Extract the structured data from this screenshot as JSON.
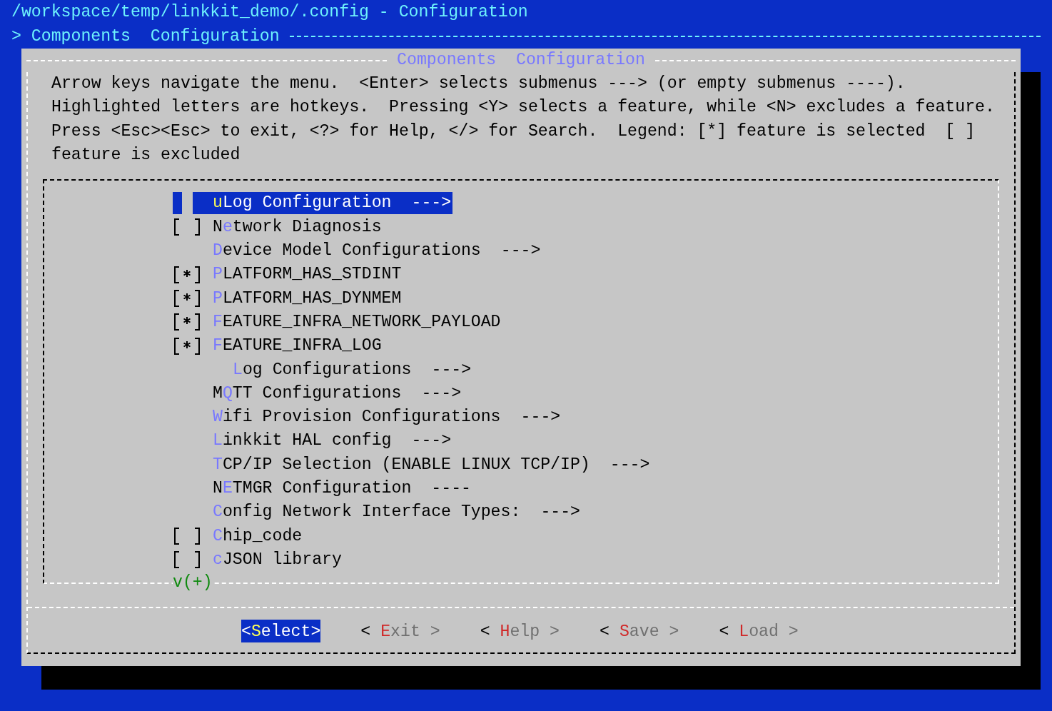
{
  "window": {
    "title": "/workspace/temp/linkkit_demo/.config - Configuration"
  },
  "breadcrumb": "> Components  Configuration",
  "dialog": {
    "title": "Components  Configuration",
    "help_lines": [
      "Arrow keys navigate the menu.  <Enter> selects submenus ---> (or empty submenus ----).",
      "Highlighted letters are hotkeys.  Pressing <Y> selects a feature, while <N> excludes a feature.",
      "Press <Esc><Esc> to exit, <?> for Help, </> for Search.  Legend: [*] feature is selected  [ ]",
      "feature is excluded"
    ]
  },
  "menu": {
    "items": [
      {
        "kind": "submenu",
        "selected": true,
        "hotkey": "u",
        "label_after": "Log Configuration",
        "suffix": "--->"
      },
      {
        "kind": "bool",
        "selected": false,
        "checked": false,
        "label_before": "N",
        "hotkey": "e",
        "label_after": "twork Diagnosis"
      },
      {
        "kind": "submenu",
        "selected": false,
        "hotkey": "D",
        "label_after": "evice Model Configurations",
        "suffix": "--->"
      },
      {
        "kind": "bool",
        "selected": false,
        "checked": true,
        "hotkey": "P",
        "label_after": "LATFORM_HAS_STDINT"
      },
      {
        "kind": "bool",
        "selected": false,
        "checked": true,
        "hotkey": "P",
        "label_after": "LATFORM_HAS_DYNMEM"
      },
      {
        "kind": "bool",
        "selected": false,
        "checked": true,
        "hotkey": "F",
        "label_after": "EATURE_INFRA_NETWORK_PAYLOAD"
      },
      {
        "kind": "bool",
        "selected": false,
        "checked": true,
        "hotkey": "F",
        "label_after": "EATURE_INFRA_LOG",
        "children": [
          {
            "kind": "submenu",
            "selected": false,
            "hotkey": "L",
            "label_after": "og Configurations",
            "suffix": "--->"
          }
        ]
      },
      {
        "kind": "submenu",
        "selected": false,
        "label_before": "M",
        "hotkey": "Q",
        "label_after": "TT Configurations",
        "suffix": "--->"
      },
      {
        "kind": "submenu",
        "selected": false,
        "hotkey": "W",
        "label_after": "ifi Provision Configurations",
        "suffix": "--->"
      },
      {
        "kind": "submenu",
        "selected": false,
        "hotkey": "L",
        "label_after": "inkkit HAL config",
        "suffix": "--->"
      },
      {
        "kind": "submenu",
        "selected": false,
        "hotkey": "T",
        "label_after": "CP/IP Selection (ENABLE LINUX TCP/IP)",
        "suffix": "--->"
      },
      {
        "kind": "submenu",
        "selected": false,
        "label_before": "N",
        "hotkey": "E",
        "label_after": "TMGR Configuration",
        "suffix": "----"
      },
      {
        "kind": "submenu",
        "selected": false,
        "hotkey": "C",
        "label_after": "onfig Network Interface Types:",
        "suffix": "--->"
      },
      {
        "kind": "bool",
        "selected": false,
        "checked": false,
        "hotkey": "C",
        "label_after": "hip_code"
      },
      {
        "kind": "bool",
        "selected": false,
        "checked": false,
        "hotkey": "c",
        "label_after": "JSON library"
      }
    ],
    "more_indicator": "v(+)"
  },
  "buttons": [
    {
      "label_before": "<",
      "hotkey": "S",
      "label_after": "elect>",
      "selected": true
    },
    {
      "label_before": "< ",
      "hotkey": "E",
      "label_after": "xit >",
      "selected": false
    },
    {
      "label_before": "< ",
      "hotkey": "H",
      "label_after": "elp >",
      "selected": false
    },
    {
      "label_before": "< ",
      "hotkey": "S",
      "label_after": "ave >",
      "selected": false
    },
    {
      "label_before": "< ",
      "hotkey": "L",
      "label_after": "oad >",
      "selected": false
    }
  ]
}
